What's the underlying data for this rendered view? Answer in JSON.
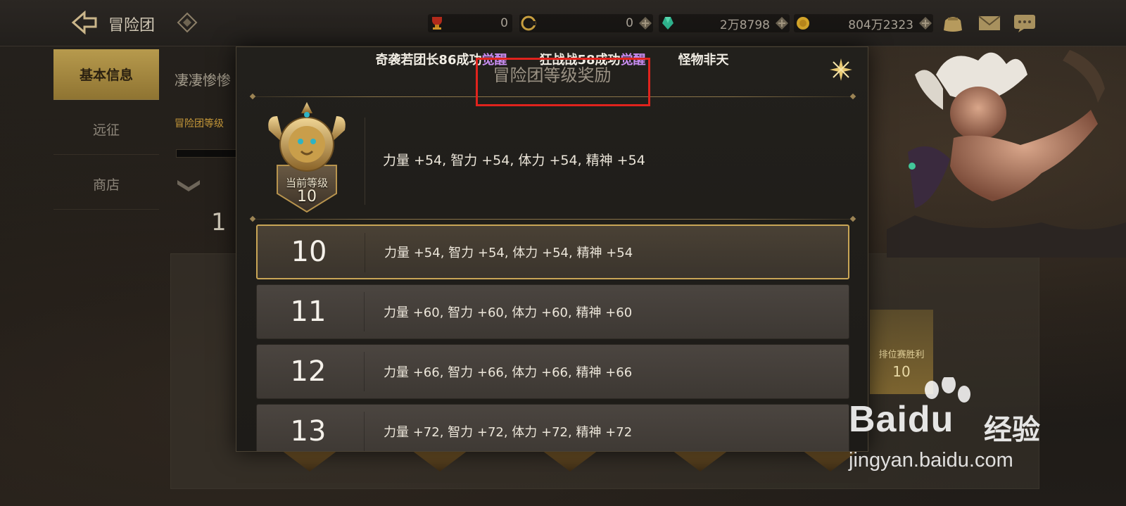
{
  "topbar": {
    "title": "冒险团",
    "currencies": [
      {
        "icon": "trophy-icon",
        "value": "0"
      },
      {
        "icon": "coin-c-icon",
        "value": "0"
      },
      {
        "icon": "gem-icon",
        "value": "2万8798"
      },
      {
        "icon": "gold-icon",
        "value": "804万2323"
      }
    ]
  },
  "sidebar": {
    "tabs": [
      {
        "label": "基本信息",
        "active": true
      },
      {
        "label": "远征",
        "active": false
      },
      {
        "label": "商店",
        "active": false
      }
    ]
  },
  "underlay": {
    "name": "凄凄惨惨",
    "sub": "冒险团等级",
    "big": "1",
    "card_label": "排位赛胜利",
    "card_value": "10"
  },
  "ticker": {
    "items": [
      {
        "text": "奇袭若团长86成功",
        "highlight": "觉醒"
      },
      {
        "text": "狂战战58成功",
        "highlight": "觉醒"
      },
      {
        "text": "怪物非天",
        "highlight": ""
      }
    ]
  },
  "modal": {
    "title": "冒险团等级奖励",
    "current": {
      "badge_label": "当前等级",
      "level": "10",
      "stats": "力量 +54, 智力 +54, 体力 +54, 精神 +54"
    },
    "levels": [
      {
        "level": "10",
        "stats": "力量 +54, 智力 +54, 体力 +54, 精神 +54",
        "active": true
      },
      {
        "level": "11",
        "stats": "力量 +60, 智力 +60, 体力 +60, 精神 +60",
        "active": false
      },
      {
        "level": "12",
        "stats": "力量 +66, 智力 +66, 体力 +66, 精神 +66",
        "active": false
      },
      {
        "level": "13",
        "stats": "力量 +72, 智力 +72, 体力 +72, 精神 +72",
        "active": false
      }
    ]
  },
  "watermark": {
    "brand": "Baidu",
    "cn": "经验",
    "url": "jingyan.baidu.com"
  },
  "colors": {
    "accent_gold": "#c9a656",
    "highlight_purple": "#c98df2",
    "annotation_red": "#e0231d"
  }
}
